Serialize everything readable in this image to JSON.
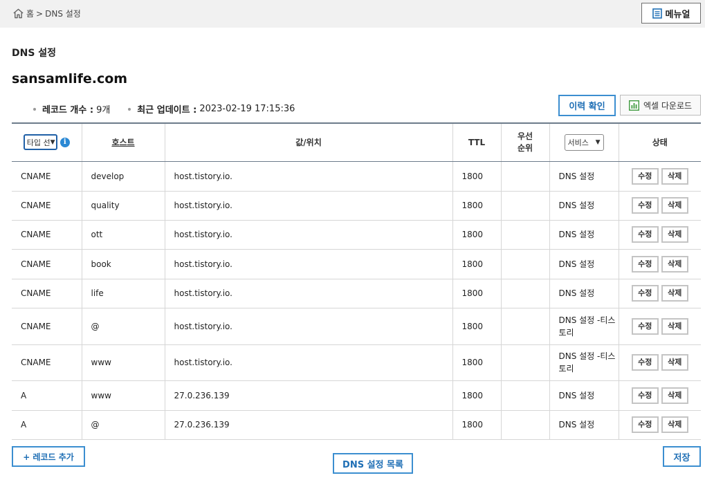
{
  "breadcrumb": {
    "home": "홈",
    "separator": ">",
    "current": "DNS 설정"
  },
  "header": {
    "manual_label": "메뉴얼"
  },
  "page": {
    "title": "DNS 설정",
    "domain": "sansamlife.com"
  },
  "summary": {
    "record_count_label": "레코드 개수 :",
    "record_count_value": "9개",
    "updated_label": "최근 업데이트 :",
    "updated_value": "2023-02-19 17:15:36"
  },
  "actions": {
    "history_label": "이력 확인",
    "excel_label": "엑셀 다운로드",
    "add_record_label": "+ 레코드 추가",
    "dns_list_label": "DNS 설정 목록",
    "save_label": "저장"
  },
  "table": {
    "headers": {
      "type_select": "타입 선",
      "host": "호스트",
      "value": "값/위치",
      "ttl": "TTL",
      "priority_line1": "우선",
      "priority_line2": "순위",
      "service_select": "서비스",
      "state": "상태"
    },
    "edit_label": "수정",
    "delete_label": "삭제",
    "rows": [
      {
        "type": "CNAME",
        "host": "develop",
        "value": "host.tistory.io.",
        "ttl": "1800",
        "priority": "",
        "service": "DNS 설정"
      },
      {
        "type": "CNAME",
        "host": "quality",
        "value": "host.tistory.io.",
        "ttl": "1800",
        "priority": "",
        "service": "DNS 설정"
      },
      {
        "type": "CNAME",
        "host": "ott",
        "value": "host.tistory.io.",
        "ttl": "1800",
        "priority": "",
        "service": "DNS 설정"
      },
      {
        "type": "CNAME",
        "host": "book",
        "value": "host.tistory.io.",
        "ttl": "1800",
        "priority": "",
        "service": "DNS 설정"
      },
      {
        "type": "CNAME",
        "host": "life",
        "value": "host.tistory.io.",
        "ttl": "1800",
        "priority": "",
        "service": "DNS 설정"
      },
      {
        "type": "CNAME",
        "host": "@",
        "value": "host.tistory.io.",
        "ttl": "1800",
        "priority": "",
        "service": "DNS 설정 -티스토리"
      },
      {
        "type": "CNAME",
        "host": "www",
        "value": "host.tistory.io.",
        "ttl": "1800",
        "priority": "",
        "service": "DNS 설정 -티스토리"
      },
      {
        "type": "A",
        "host": "www",
        "value": "27.0.236.139",
        "ttl": "1800",
        "priority": "",
        "service": "DNS 설정"
      },
      {
        "type": "A",
        "host": "@",
        "value": "27.0.236.139",
        "ttl": "1800",
        "priority": "",
        "service": "DNS 설정"
      }
    ]
  },
  "icons": {
    "home": "home-icon",
    "manual": "document-icon",
    "info": "info-icon",
    "excel": "excel-chart-icon",
    "dropdown": "chevron-down-icon"
  },
  "colors": {
    "accent": "#3b8ed0",
    "accent_text": "#1f6fb5",
    "topbar": "#f1f1f1",
    "info": "#2a88d4",
    "excel": "#3f9a3f"
  }
}
